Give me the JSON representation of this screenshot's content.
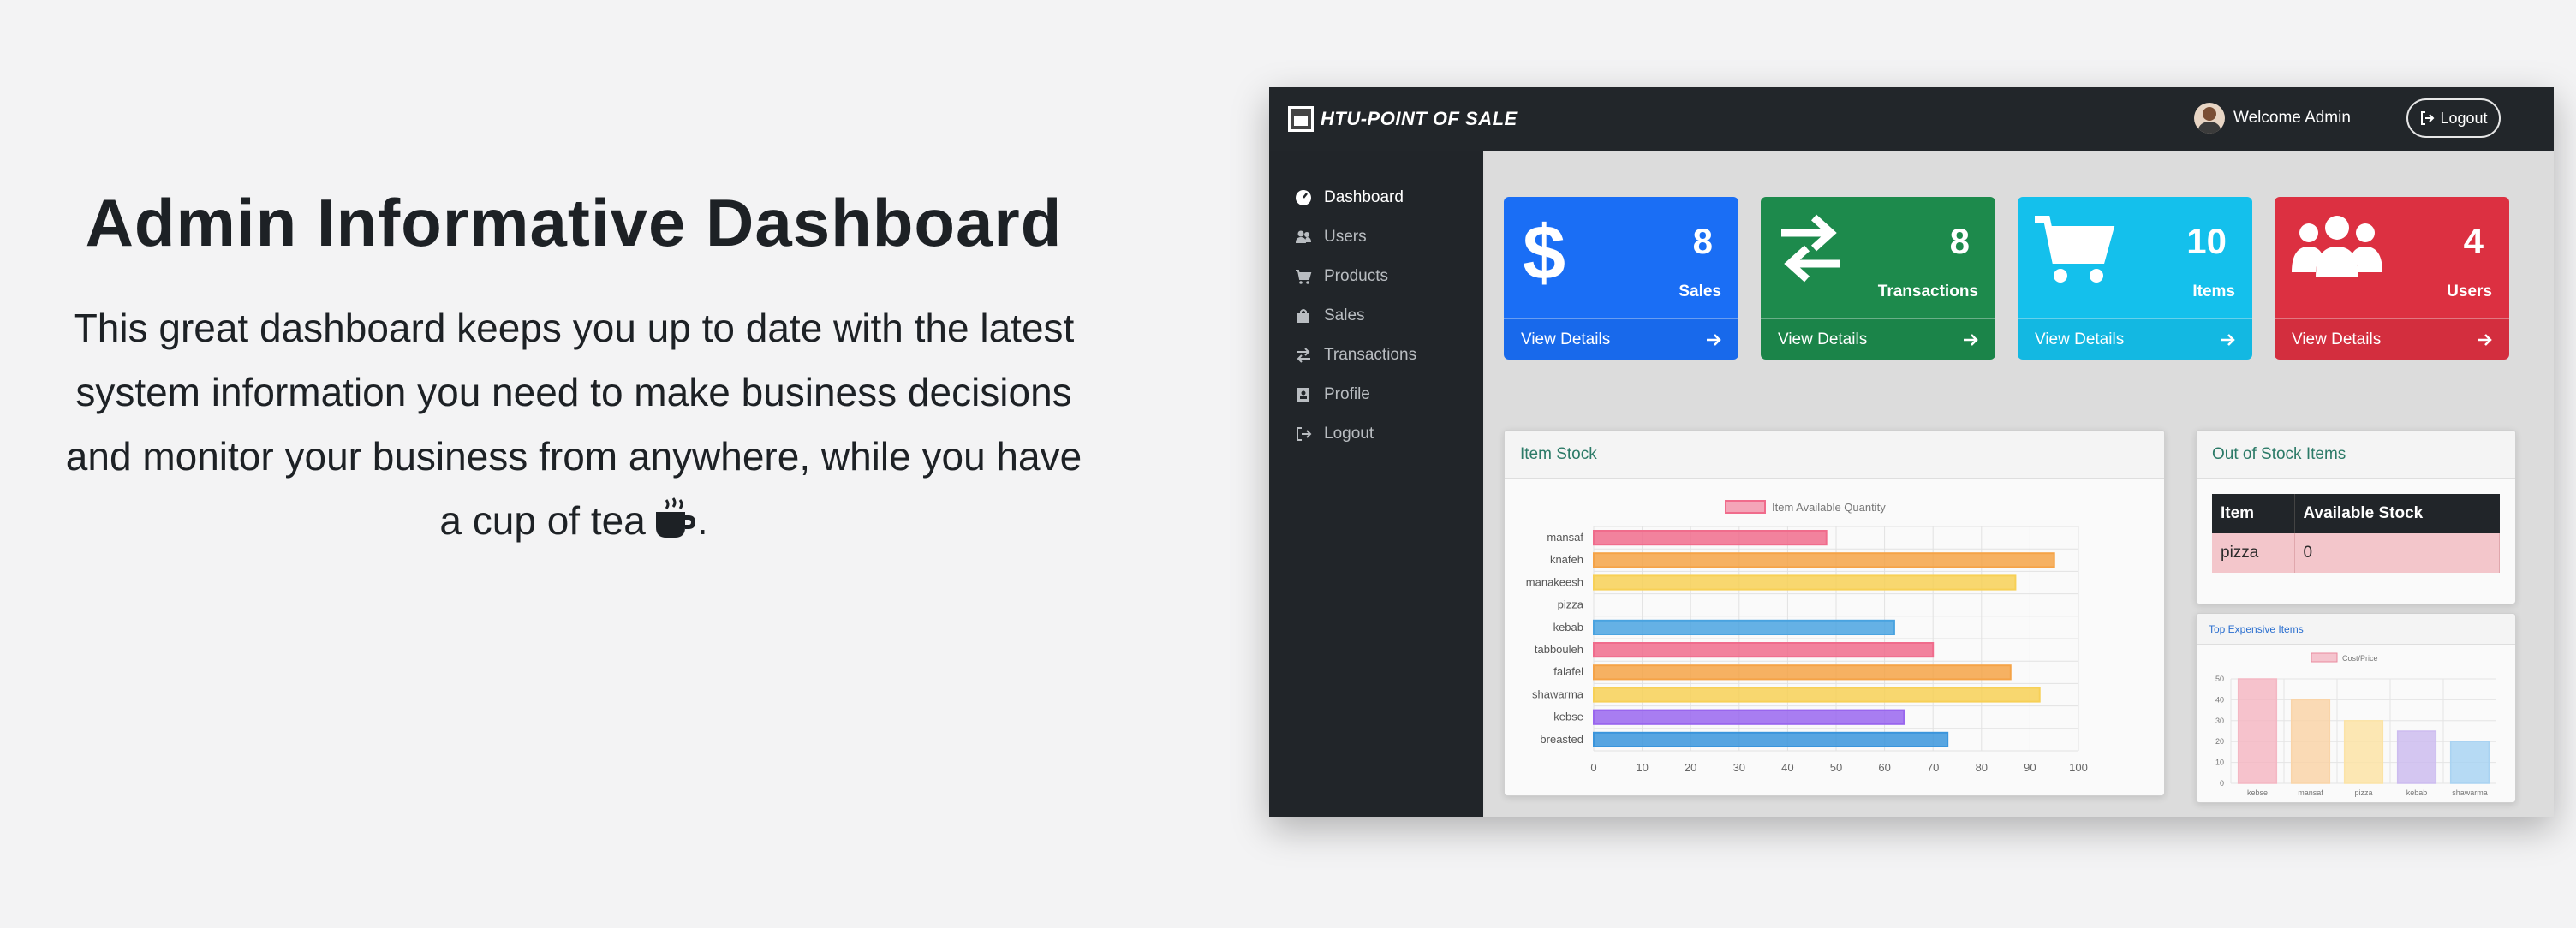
{
  "promo": {
    "title": "Admin Informative Dashboard",
    "text": "This great dashboard keeps you up to date with the latest system information you need to make business decisions and monitor your business from anywhere, while you have a cup of tea",
    "text_end": "."
  },
  "app": {
    "brand": "HTU-POINT OF SALE",
    "welcome": "Welcome Admin",
    "logout_label": "Logout"
  },
  "sidebar": {
    "items": [
      {
        "label": "Dashboard",
        "icon": "gauge-icon",
        "active": true
      },
      {
        "label": "Users",
        "icon": "users-icon"
      },
      {
        "label": "Products",
        "icon": "cart-icon"
      },
      {
        "label": "Sales",
        "icon": "bag-icon"
      },
      {
        "label": "Transactions",
        "icon": "arrows-icon"
      },
      {
        "label": "Profile",
        "icon": "id-card-icon"
      },
      {
        "label": "Logout",
        "icon": "logout-icon"
      }
    ]
  },
  "cards": [
    {
      "value": "8",
      "label": "Sales",
      "link": "View Details",
      "color": "#1a6ef5",
      "icon": "dollar-icon"
    },
    {
      "value": "8",
      "label": "Transactions",
      "link": "View Details",
      "color": "#1d8a4c",
      "icon": "exchange-icon"
    },
    {
      "value": "10",
      "label": "Items",
      "link": "View Details",
      "color": "#14c0ec",
      "icon": "cart-icon"
    },
    {
      "value": "4",
      "label": "Users",
      "link": "View Details",
      "color": "#dc3041",
      "icon": "users-icon"
    }
  ],
  "item_stock": {
    "title": "Item Stock",
    "legend": "Item Available Quantity"
  },
  "out_of_stock": {
    "title": "Out of Stock Items",
    "headers": [
      "Item",
      "Available Stock"
    ],
    "rows": [
      [
        "pizza",
        "0"
      ]
    ]
  },
  "top_expensive": {
    "title": "Top Expensive Items",
    "legend": "Cost/Price"
  },
  "chart_data": [
    {
      "type": "bar",
      "orientation": "horizontal",
      "title": "Item Stock",
      "categories": [
        "mansaf",
        "knafeh",
        "manakeesh",
        "pizza",
        "kebab",
        "tabbouleh",
        "falafel",
        "shawarma",
        "kebse",
        "breasted"
      ],
      "series": [
        {
          "name": "Item Available Quantity",
          "values": [
            48,
            95,
            87,
            0,
            62,
            70,
            86,
            92,
            64,
            73
          ]
        }
      ],
      "colors": [
        "#f06c8c",
        "#f5a347",
        "#f7d056",
        "#4aa3e0",
        "#4aa3e0",
        "#f06c8c",
        "#f5a347",
        "#f7d056",
        "#9966ee",
        "#3a95dc"
      ],
      "xlim": [
        0,
        100
      ],
      "xticks": [
        0,
        10,
        20,
        30,
        40,
        50,
        60,
        70,
        80,
        90,
        100
      ],
      "grid": true,
      "legend": "top"
    },
    {
      "type": "bar",
      "title": "Top Expensive Items",
      "categories": [
        "kebse",
        "mansaf",
        "pizza",
        "kebab",
        "shawarma"
      ],
      "series": [
        {
          "name": "Cost/Price",
          "values": [
            50,
            40,
            30,
            25,
            20
          ]
        }
      ],
      "colors": [
        "#f4b7c3",
        "#f9d4a8",
        "#fbe3a6",
        "#cdbcef",
        "#a9d3f2"
      ],
      "ylim": [
        0,
        50
      ],
      "yticks": [
        0,
        10,
        20,
        30,
        40,
        50
      ],
      "grid": true,
      "legend": "top"
    }
  ]
}
